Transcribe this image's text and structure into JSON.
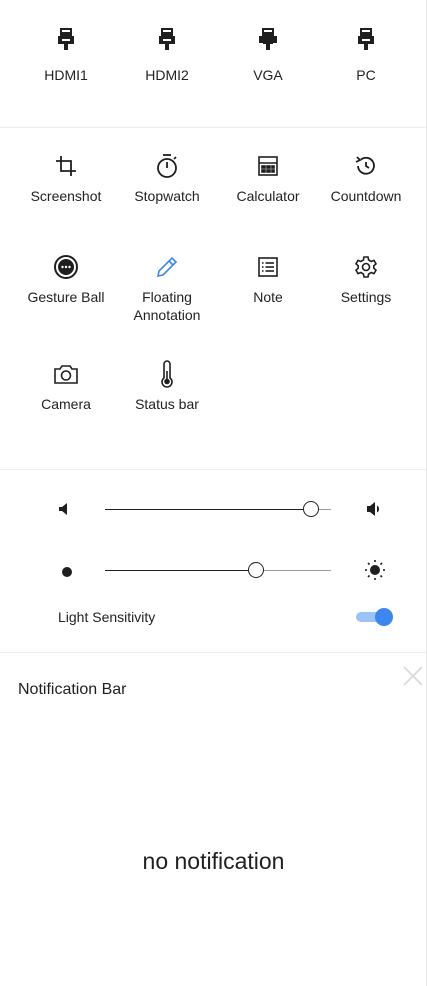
{
  "sources": [
    {
      "label": "HDMI1",
      "icon": "hdmi-plug-icon"
    },
    {
      "label": "HDMI2",
      "icon": "hdmi-plug-icon"
    },
    {
      "label": "VGA",
      "icon": "vga-plug-icon"
    },
    {
      "label": "PC",
      "icon": "pc-plug-icon"
    }
  ],
  "tools": [
    {
      "label": "Screenshot",
      "icon": "crop-icon"
    },
    {
      "label": "Stopwatch",
      "icon": "stopwatch-icon"
    },
    {
      "label": "Calculator",
      "icon": "calculator-icon"
    },
    {
      "label": "Countdown",
      "icon": "countdown-icon"
    },
    {
      "label": "Gesture Ball",
      "icon": "gesture-ball-icon"
    },
    {
      "label": "Floating\nAnnotation",
      "icon": "pencil-icon"
    },
    {
      "label": "Note",
      "icon": "note-icon"
    },
    {
      "label": "Settings",
      "icon": "gear-icon"
    },
    {
      "label": "Camera",
      "icon": "camera-icon"
    },
    {
      "label": "Status bar",
      "icon": "thermometer-icon"
    }
  ],
  "controls": {
    "volume_level": 0.91,
    "brightness_level": 0.67,
    "light_sensitivity_label": "Light Sensitivity",
    "light_sensitivity_on": true
  },
  "notifications": {
    "title": "Notification Bar",
    "empty_text": "no notification"
  },
  "colors": {
    "accent": "#3c86ee",
    "accent_light": "#9cc3f5",
    "text": "#222222"
  }
}
